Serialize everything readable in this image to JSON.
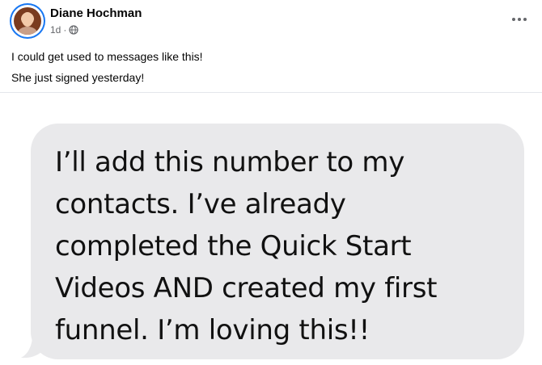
{
  "post": {
    "author": "Diane Hochman",
    "timestamp": "1d",
    "separator": "·",
    "audience_icon": "globe-icon",
    "more_icon": "more-horizontal-icon",
    "caption_lines": [
      "I could get used to messages like this!",
      "She just signed yesterday!"
    ]
  },
  "message_image": {
    "lines": [
      "I’ll add this number to my",
      "contacts. I’ve already",
      "completed the Quick Start",
      "Videos AND created my first",
      "funnel. I’m loving this!!"
    ],
    "bubble_color": "#e9e9eb"
  },
  "colors": {
    "accent": "#1877f2",
    "secondary_text": "#65676b"
  }
}
